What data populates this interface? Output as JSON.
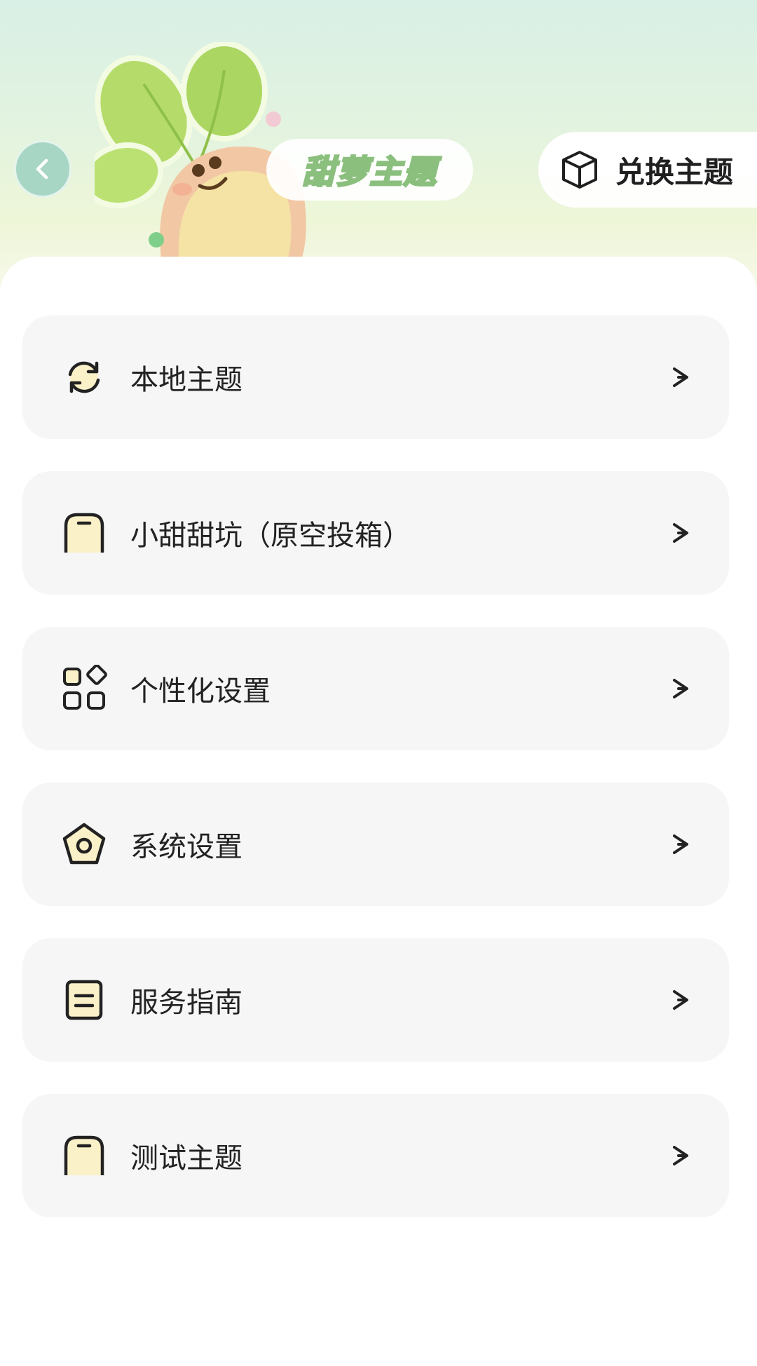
{
  "header": {
    "theme_title": "甜萝主题",
    "exchange_label": "兑换主题"
  },
  "icons": {
    "back": "chevron-left-icon",
    "exchange": "cube-icon",
    "mascot": "radish-mascot"
  },
  "colors": {
    "header_top": "#d9f0e6",
    "header_bottom": "#f6f8ea",
    "back_button": "#a8d6c5",
    "card_bg": "#f6f6f6",
    "text": "#222222",
    "title_fill": "#cfe6c3",
    "title_stroke": "#8bbf7d"
  },
  "menu": [
    {
      "label": "本地主题",
      "icon": "refresh-icon"
    },
    {
      "label": "小甜甜坑（原空投箱）",
      "icon": "box-icon"
    },
    {
      "label": "个性化设置",
      "icon": "apps-grid-icon"
    },
    {
      "label": "系统设置",
      "icon": "settings-pentagon-icon"
    },
    {
      "label": "服务指南",
      "icon": "document-icon"
    },
    {
      "label": "测试主题",
      "icon": "box-icon"
    }
  ]
}
